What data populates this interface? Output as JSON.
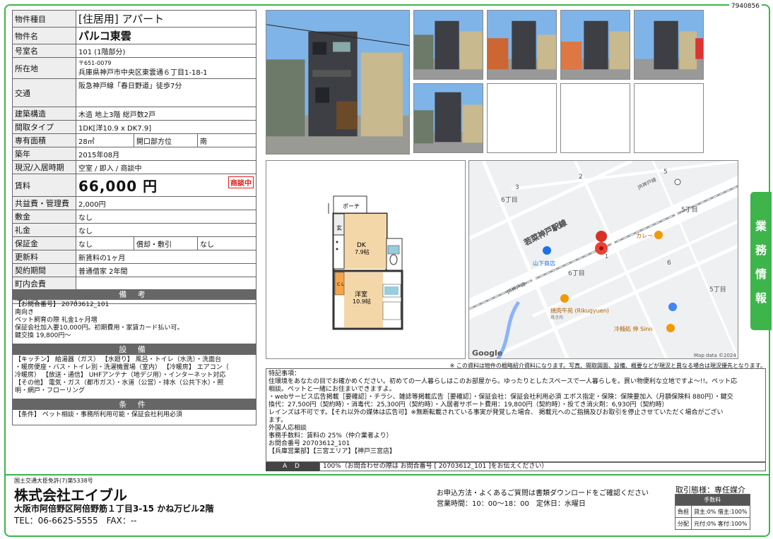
{
  "doc_id": "7940856",
  "property": {
    "type_label": "物件種目",
    "type_value": "[住居用] アパート",
    "name_label": "物件名",
    "name_value": "パルコ東雲",
    "room_label": "号室名",
    "room_value": "101 (1階部分)",
    "address_label": "所在地",
    "zip": "〒651-0079",
    "address_value": "兵庫県神戸市中央区東雲通６丁目1-18-1",
    "transport_label": "交通",
    "transport_value": "阪急神戸線「春日野道」徒歩7分",
    "structure_label": "建築構造",
    "structure_value": "木造 地上3階 総戸数2戸",
    "layout_label": "間取タイプ",
    "layout_value": "1DK[洋10.9 x DK7.9]",
    "area_label": "専有面積",
    "area_value": "28㎡",
    "direction_label": "開口部方位",
    "direction_value": "南",
    "built_label": "築年",
    "built_value": "2015年08月",
    "status_label": "現況/入居時期",
    "status_value": "空室 / 即入 / 商談中",
    "rent_label": "賃料",
    "rent_value": "66,000 円",
    "nego_badge": "商談中",
    "common_label": "共益費・管理費",
    "common_value": "2,000円",
    "deposit_label": "敷金",
    "deposit_value": "なし",
    "key_money_label": "礼金",
    "key_money_value": "なし",
    "guarantee_label": "保証金",
    "guarantee_value": "なし",
    "amort_label": "償却・敷引",
    "amort_value": "なし",
    "renewal_label": "更新料",
    "renewal_value": "新賃料の1ヶ月",
    "contract_label": "契約期間",
    "contract_value": "普通借家 2年間",
    "town_fee_label": "町内会費",
    "town_fee_value": "",
    "parking_label": "駐車場",
    "parking_value": ""
  },
  "remarks": {
    "title": "備 考",
    "text": "【お問合番号】 20703612_101\n南向き\nペット飼育の際 礼金1ヶ月増\n保証会社加入要10,000円。初期費用・家賃カード払い可。\n鍵交換 19,800円～"
  },
  "equipment": {
    "title": "設 備",
    "text": "【キッチン】 給湯器（ガス） 【水廻り】 風呂・トイレ（水洗）・洗面台\n・暖房便座・バス・トイレ別・洗濯機置場（室内） 【冷暖房】 エアコン（\n冷暖房） 【放送・通信】 UHFアンテナ（地デジ用）・インターネット対応\n【その他】 電気・ガス（都市ガス）・水道（公営）・排水（公共下水）・照\n明・網戸・フローリング"
  },
  "conditions": {
    "title": "条 件",
    "text": "【条件】 ペット相談・事務所利用可能・保証会社利用必須"
  },
  "floorplan": {
    "porch": "ポーチ",
    "genkan": "玄",
    "dk": "DK",
    "dk_size": "7.9帖",
    "closet": "C\nL",
    "western": "洋室",
    "western_size": "10.9帖"
  },
  "map": {
    "area1": "6丁目",
    "area2": "5丁目",
    "area3": "6丁目",
    "area4": "5丁目",
    "rail": "若菜神戸駅線",
    "jr1": "JR神戸線",
    "jr2": "JR神戸線",
    "shop1": "山下商店",
    "shop2": "カレー",
    "shop3": "焼肉牛苑 (Rikugyuen)",
    "shop3_sub": "焼き肉",
    "shop4": "冷麺処 伸 Sinn",
    "google": "Google",
    "credit": "Map data ©2024",
    "n1": "1",
    "n2": "2",
    "n3": "3",
    "n4": "5",
    "n5": "6"
  },
  "side_tab": [
    "業",
    "務",
    "情",
    "報"
  ],
  "disclaimer": "※ この資料は物件の概略紹介資料になります。写真、間取図面、設備、概要などが現況と異なる場合は現況優先となります。",
  "notes": "特記事項：\n住環境をあなたの目でお確かめください。初めての一人暮らしはこのお部屋から。ゆったりとしたスペースで一人暮らしを。買い物便利な立地ですよ～!!。ペット応\n相談。ペットと一緒にお住まいできますよ。\n・webサービス広告掲載［要確認］・チラシ、雑誌等掲載広告［要確認］・保証会社：保証会社利用必須 エポス指定・保険：保険要加入（月額保険料 880円）・鍵交\n換代：27,500円（契約時）・消毒代：25,300円（契約時）・入居者サポート費用：19,800円（契約時）・投てき消火剤：6,930円（契約時）\nレインズは不可です。【それ以外の媒体は広告可】※無断転載されている事実が発覚した場合、 掲載元へのご指摘及びお取引を停止させていただく場合がござい\nます。\n外国人応相談\n事務手数料：賃料の 25%（仲介業者より）\nお問合番号 20703612_101\n【兵庫営業部】【三宮エリア】【神戸三宮店】",
  "ad": {
    "label": "A D",
    "text": "100%（お問合わせの際は お問合番号 [ 20703612_101 ]をお伝えください）"
  },
  "company": {
    "license": "国土交通大臣免許(7)第5338号",
    "name": "株式会社エイブル",
    "address": "大阪市阿倍野区阿倍野筋１丁目3-15 かね万ビル2階",
    "tel": "TEL：06-6625-5555　FAX：--"
  },
  "contact": {
    "line1": "お申込方法・よくあるご質問は書類ダウンロードをご確認ください",
    "line2": "営業時間：10：00～18：00　定休日：水曜日"
  },
  "deal": {
    "type": "取引態様：専任媒介",
    "fee_header": "手数料",
    "burden_label": "負担",
    "burden_value": "貸主:0% 借主:100%",
    "dist_label": "分配",
    "dist_value": "元付:0% 客付:100%"
  }
}
